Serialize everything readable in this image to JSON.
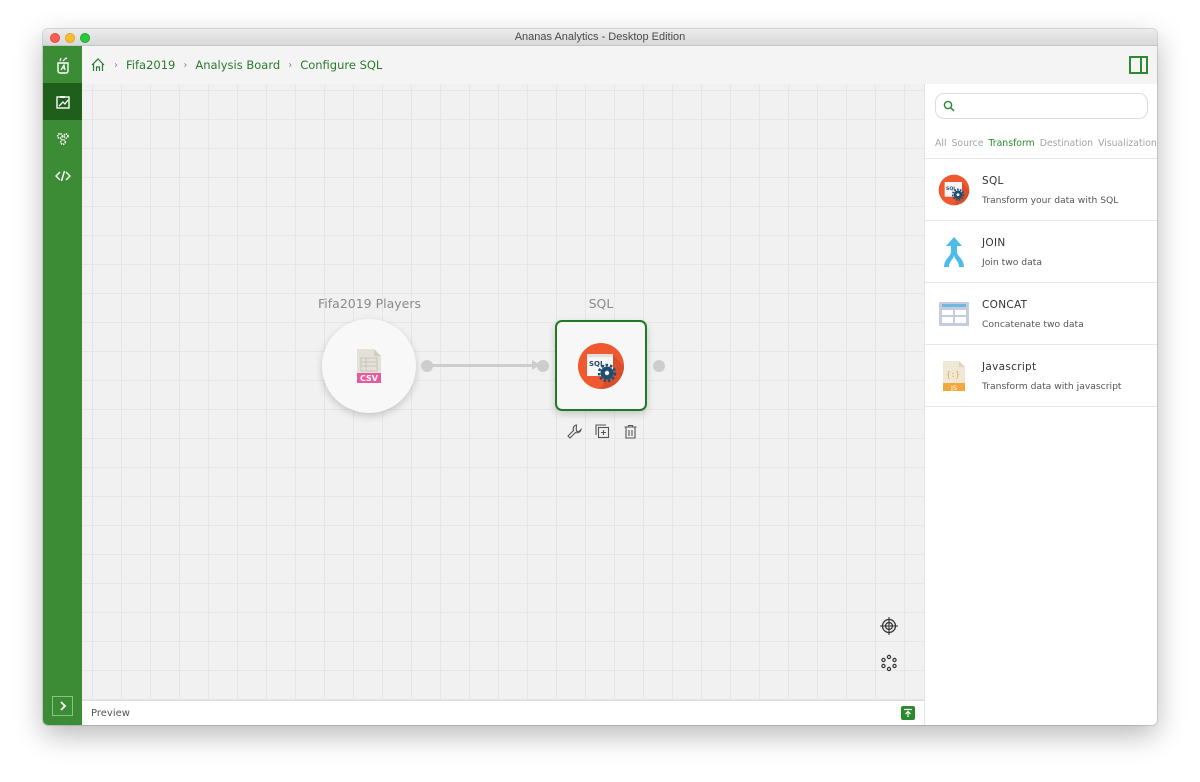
{
  "window": {
    "title": "Ananas Analytics - Desktop Edition"
  },
  "sidebar": {
    "items": [
      {
        "name": "app-logo",
        "icon": "ananas-logo-icon",
        "active": false
      },
      {
        "name": "analysis-board",
        "icon": "board-icon",
        "active": true
      },
      {
        "name": "execution",
        "icon": "gears-icon",
        "active": false
      },
      {
        "name": "developer",
        "icon": "code-icon",
        "active": false
      }
    ],
    "expand_icon": "chevron-right-icon"
  },
  "breadcrumb": {
    "home_icon": "home-icon",
    "items": [
      "Fifa2019",
      "Analysis Board",
      "Configure SQL"
    ]
  },
  "canvas": {
    "nodes": [
      {
        "label": "Fifa2019 Players",
        "icon": "csv-file-icon",
        "icon_text": "CSV",
        "shape": "circle",
        "selected": false
      },
      {
        "label": "SQL",
        "icon": "sql-icon",
        "icon_text": "SQL",
        "shape": "square",
        "selected": true
      }
    ],
    "node_actions": [
      "wrench-icon",
      "duplicate-icon",
      "trash-icon"
    ],
    "tools": [
      "center-target-icon",
      "auto-layout-icon"
    ]
  },
  "preview": {
    "label": "Preview",
    "toggle_icon": "expand-up-icon"
  },
  "right_panel": {
    "search": {
      "placeholder": "",
      "value": ""
    },
    "tabs": [
      {
        "label": "All",
        "active": false
      },
      {
        "label": "Source",
        "active": false
      },
      {
        "label": "Transform",
        "active": true
      },
      {
        "label": "Destination",
        "active": false
      },
      {
        "label": "Visualization",
        "active": false
      }
    ],
    "items": [
      {
        "title": "SQL",
        "description": "Transform your data with SQL",
        "icon": "sql-icon"
      },
      {
        "title": "JOIN",
        "description": "Join two data",
        "icon": "join-arrow-icon"
      },
      {
        "title": "CONCAT",
        "description": "Concatenate two data",
        "icon": "concat-table-icon"
      },
      {
        "title": "Javascript",
        "description": "Transform data with javascript",
        "icon": "javascript-file-icon",
        "icon_text": "JS"
      }
    ]
  },
  "colors": {
    "brand_green": "#3b8c35",
    "active_green": "#1e5f1c",
    "link_green": "#2a7a2e",
    "sql_orange": "#f0582f",
    "csv_pink": "#e75a9c",
    "join_blue": "#4bbde8"
  }
}
